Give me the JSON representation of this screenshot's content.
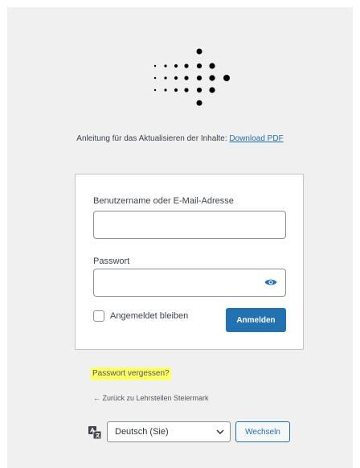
{
  "instructions": {
    "text": "Anleitung für das Aktualisieren der Inhalte: ",
    "link_label": "Download PDF"
  },
  "login_form": {
    "username_label": "Benutzername oder E-Mail-Adresse",
    "username_value": "",
    "password_label": "Passwort",
    "password_value": "",
    "remember_label": "Angemeldet bleiben",
    "submit_label": "Anmelden"
  },
  "links": {
    "lost_password": "Passwort vergessen?",
    "back_to_site": "← Zurück zu Lehrstellen Steiermark"
  },
  "language": {
    "selected": "Deutsch (Sie)",
    "change_label": "Wechseln"
  },
  "colors": {
    "accent": "#2271b1",
    "background": "#f0f0f1",
    "highlight": "#ffff66",
    "logo": "#000000"
  },
  "icons": {
    "logo": "dotted-arrow-logo",
    "password_toggle": "eye-icon",
    "language": "translate-icon",
    "select_arrow": "chevron-down-icon"
  }
}
